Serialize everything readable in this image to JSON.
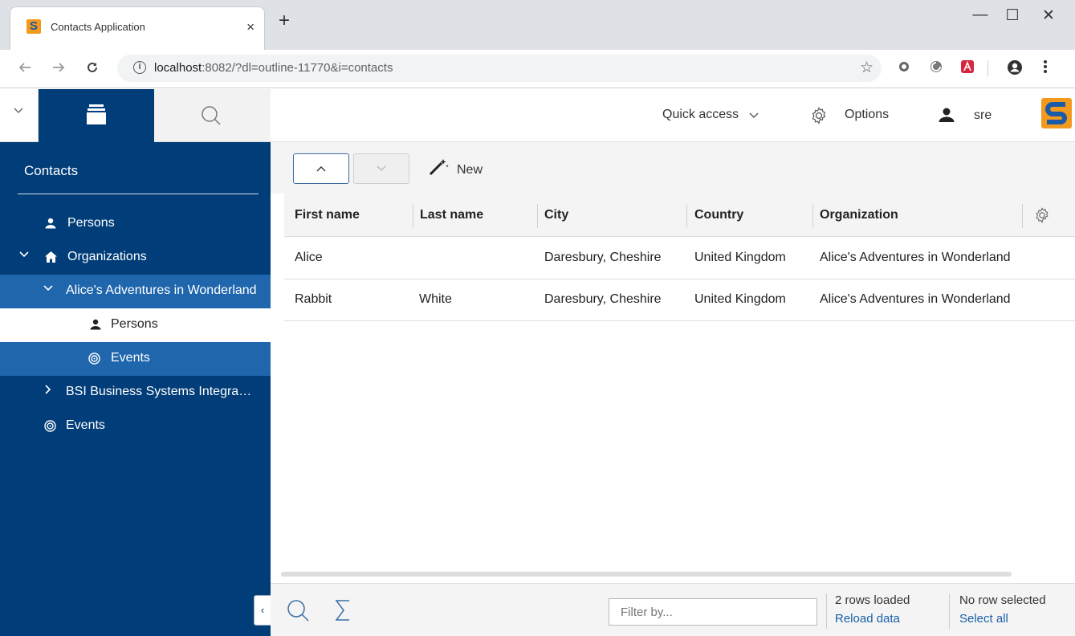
{
  "browser": {
    "tab_title": "Contacts Application",
    "tab_close": "×",
    "new_tab": "+",
    "url_host": "localhost",
    "url_rest": ":8082/?dl=outline-11770&i=contacts",
    "window_minimize": "—",
    "window_maximize": "☐",
    "window_close": "✕",
    "icons": [
      "back-arrow-icon",
      "forward-arrow-icon",
      "reload-icon",
      "info-icon",
      "star-icon",
      "extension-icon",
      "profile-icon",
      "menu-dots-icon"
    ]
  },
  "nav": {
    "title": "Contacts",
    "items": [
      {
        "label": "Persons",
        "icon": "person-icon",
        "level": 0
      },
      {
        "label": "Organizations",
        "icon": "home-icon",
        "level": 0,
        "expanded": true
      },
      {
        "label": "Alice's Adventures in Wonderland",
        "level": 1,
        "expanded": true,
        "selected": true
      },
      {
        "label": "Persons",
        "icon": "person-icon",
        "level": 2
      },
      {
        "label": "Events",
        "icon": "target-icon",
        "level": 2,
        "selected": true
      },
      {
        "label": "BSI Business Systems Integration",
        "level": 1,
        "expanded": false
      },
      {
        "label": "Events",
        "icon": "target-icon",
        "level": 0
      }
    ],
    "collapse_handle": "‹"
  },
  "header": {
    "quick_access": "Quick access",
    "options": "Options",
    "user": "sre"
  },
  "toolbar": {
    "new_label": "New"
  },
  "table": {
    "columns": [
      "First name",
      "Last name",
      "City",
      "Country",
      "Organization"
    ],
    "rows": [
      [
        "Alice",
        "",
        "Daresbury, Cheshire",
        "United Kingdom",
        "Alice's Adventures in Wonderland"
      ],
      [
        "Rabbit",
        "White",
        "Daresbury, Cheshire",
        "United Kingdom",
        "Alice's Adventures in Wonderland"
      ]
    ]
  },
  "footer": {
    "filter_placeholder": "Filter by...",
    "rows_loaded": "2 rows loaded",
    "reload": "Reload data",
    "selection": "No row selected",
    "select_all": "Select all"
  },
  "colors": {
    "nav_background": "#013d78",
    "nav_selected": "#1f66ad",
    "accent": "#3a6ea5",
    "link": "#1a5fa8",
    "logo_orange": "#f39a1e"
  }
}
